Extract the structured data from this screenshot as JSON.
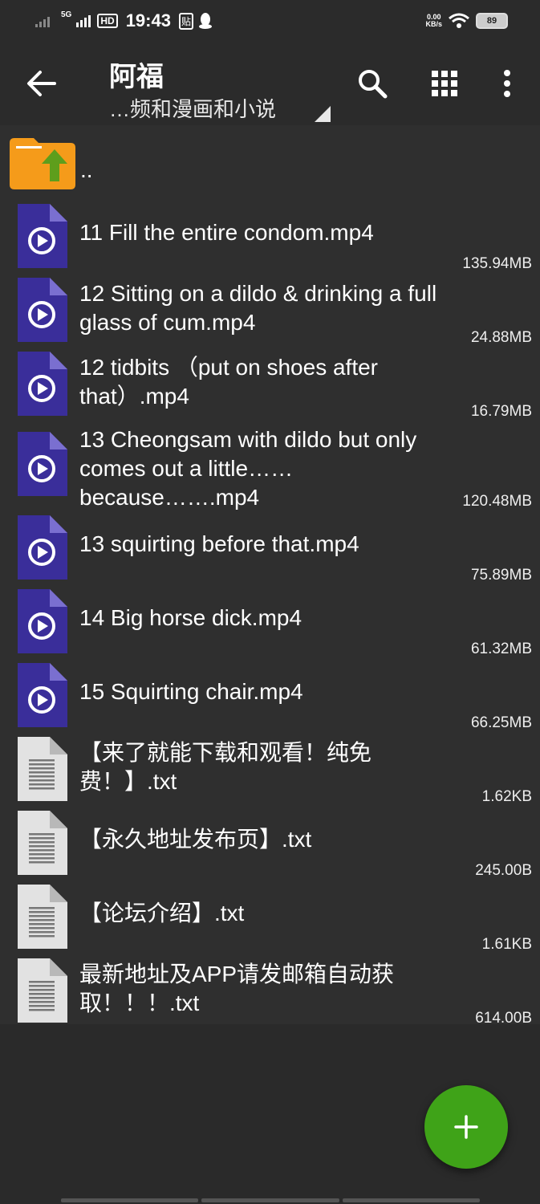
{
  "status_bar": {
    "network": "5G",
    "hd_badge": "HD",
    "time": "19:43",
    "note_badge": "贴",
    "net_speed_value": "0.00",
    "net_speed_unit": "KB/s",
    "battery": "89"
  },
  "toolbar": {
    "title": "阿福",
    "path": "…频和漫画和小说",
    "icons": [
      "back-arrow-icon",
      "search-icon",
      "grid-view-icon",
      "more-vert-icon"
    ]
  },
  "list": {
    "parent_label": "..",
    "files": [
      {
        "name": "11 Fill the entire condom.mp4",
        "size": "135.94MB",
        "type": "video"
      },
      {
        "name": "12 Sitting on a dildo & drinking a full glass of cum.mp4",
        "size": "24.88MB",
        "type": "video"
      },
      {
        "name": "12 tidbits （put on shoes after that）.mp4",
        "size": "16.79MB",
        "type": "video"
      },
      {
        "name": "13 Cheongsam with dildo but only comes out a little…… because…….mp4",
        "size": "120.48MB",
        "type": "video"
      },
      {
        "name": "13 squirting before that.mp4",
        "size": "75.89MB",
        "type": "video"
      },
      {
        "name": "14 Big horse dick.mp4",
        "size": "61.32MB",
        "type": "video"
      },
      {
        "name": "15 Squirting chair.mp4",
        "size": "66.25MB",
        "type": "video"
      },
      {
        "name": "【来了就能下载和观看！纯免费！】.txt",
        "size": "1.62KB",
        "type": "text"
      },
      {
        "name": "【永久地址发布页】.txt",
        "size": "245.00B",
        "type": "text"
      },
      {
        "name": "【论坛介绍】.txt",
        "size": "1.61KB",
        "type": "text"
      },
      {
        "name": "最新地址及APP请发邮箱自动获取！！！.txt",
        "size": "614.00B",
        "type": "text"
      }
    ]
  },
  "fab": {
    "icon": "plus-icon"
  },
  "colors": {
    "background": "#2f2f2f",
    "toolbar": "#2b2b2b",
    "video_icon": "#3a2e9a",
    "folder": "#f59b1a",
    "fab": "#3fa318"
  }
}
